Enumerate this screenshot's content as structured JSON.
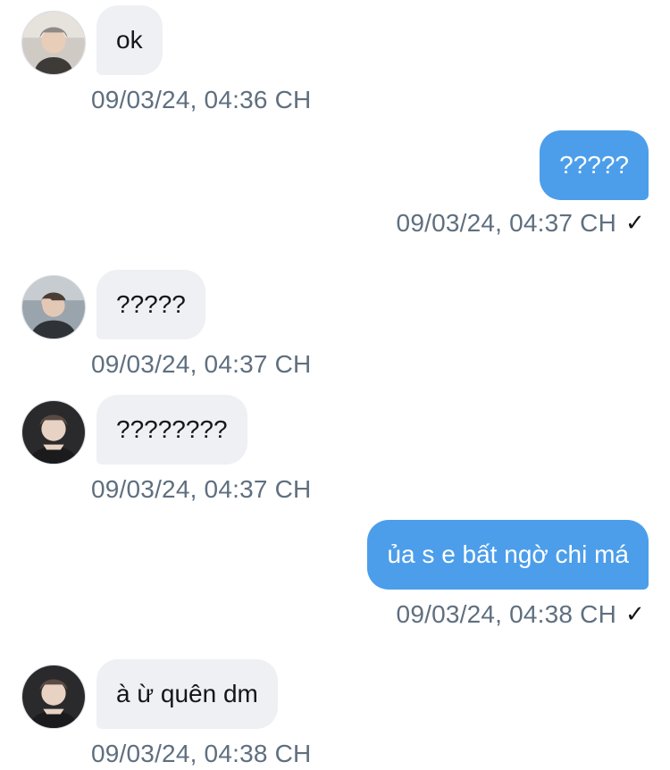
{
  "conversation": {
    "messages": [
      {
        "direction": "in",
        "text": "ok",
        "timestamp": "09/03/24, 04:36 CH",
        "avatar": "avatar-user-1"
      },
      {
        "direction": "out",
        "text": "?????",
        "timestamp": "09/03/24, 04:37 CH",
        "status": "sent-check-icon"
      },
      {
        "direction": "in",
        "text": "?????",
        "timestamp": "09/03/24, 04:37 CH",
        "avatar": "avatar-user-2"
      },
      {
        "direction": "in",
        "text": "????????",
        "timestamp": "09/03/24, 04:37 CH",
        "avatar": "avatar-user-3"
      },
      {
        "direction": "out",
        "text": "ủa s e bất ngờ chi má",
        "timestamp": "09/03/24, 04:38 CH",
        "status": "sent-check-icon"
      },
      {
        "direction": "in",
        "text": "à ừ quên dm",
        "timestamp": "09/03/24, 04:38 CH",
        "avatar": "avatar-user-3"
      }
    ],
    "check_glyph": "✓",
    "colors": {
      "outgoing_bubble": "#4c9eea",
      "incoming_bubble": "#eef0f3",
      "timestamp": "#5f6f7f"
    }
  }
}
